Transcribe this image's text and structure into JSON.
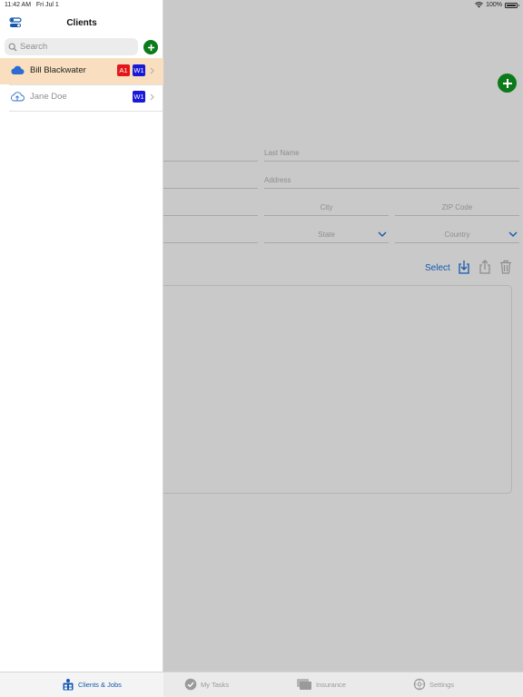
{
  "status_bar": {
    "time": "11:42 AM",
    "date": "Fri Jul 1",
    "battery": "100%"
  },
  "sidebar": {
    "title": "Clients",
    "search": {
      "placeholder": "Search",
      "value": ""
    },
    "clients": [
      {
        "name": "Bill Blackwater",
        "badges": [
          "A1",
          "W1"
        ],
        "selected": true
      },
      {
        "name": "Jane Doe",
        "badges": [
          "W1"
        ],
        "selected": false
      }
    ]
  },
  "detail": {
    "fields": {
      "last_name": "Last Name",
      "address": "Address",
      "city": "City",
      "zip": "ZIP Code",
      "state": "State",
      "country": "Country"
    },
    "toolbar": {
      "select_label": "Select"
    }
  },
  "tabs": [
    {
      "label": "Clients & Jobs",
      "icon": "clients-jobs-icon",
      "active": true
    },
    {
      "label": "My Tasks",
      "icon": "checkmark-circle-icon",
      "active": false
    },
    {
      "label": "Insurance",
      "icon": "documents-icon",
      "active": false
    },
    {
      "label": "Settings",
      "icon": "gear-icon",
      "active": false
    }
  ],
  "colors": {
    "accent": "#1458b0",
    "add_green": "#0c7a1a",
    "selected_row": "#f9dfbf",
    "badge_red": "#e3161a",
    "badge_blue": "#1919d8",
    "dim_overlay": "#c9c9c9"
  }
}
